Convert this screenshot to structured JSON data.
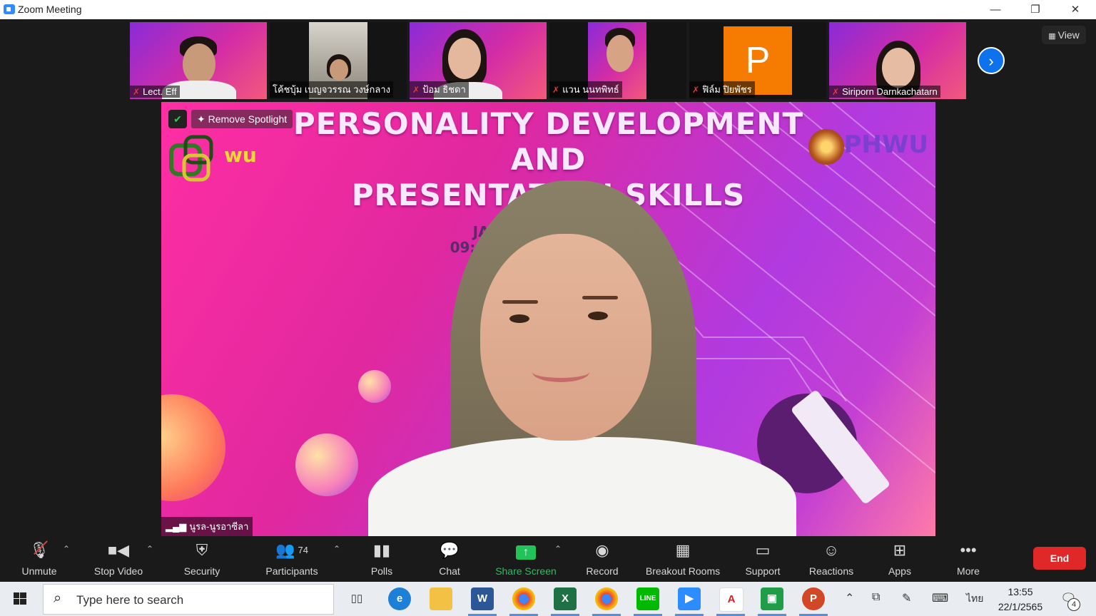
{
  "window": {
    "title": "Zoom Meeting",
    "minimize": "—",
    "restore": "❐",
    "close": "✕"
  },
  "gallery": {
    "participants": [
      {
        "name": "Lect. Eff"
      },
      {
        "name": "โค้ชบุ้ม เบญจวรรณ วงษ์กลาง"
      },
      {
        "name": "ป้อม ธิชดา"
      },
      {
        "name": "แวน นนทพิทธ์"
      },
      {
        "name": "ฟิล์ม ปิยพัชร"
      },
      {
        "name": "Siriporn Darnkachatarn"
      }
    ],
    "avatar_letter": "P",
    "view_label": "View"
  },
  "spotlight": {
    "remove_label": "Remove Spotlight",
    "speaker_name": "นูรล-นูรอาซีลา",
    "slide_title_1": "PERSONALITY DEVELOPMENT",
    "slide_title_2": "AND",
    "slide_title_3": "PRESENTATION SKILLS",
    "slide_date": "JANUARY 2          ONLINE",
    "slide_time": "09:",
    "logo_right": "PHWU",
    "logo_left": "wu"
  },
  "toolbar": {
    "unmute": "Unmute",
    "stop_video": "Stop Video",
    "security": "Security",
    "participants": "Participants",
    "participant_count": "74",
    "polls": "Polls",
    "chat": "Chat",
    "share_screen": "Share Screen",
    "record": "Record",
    "breakout_rooms": "Breakout Rooms",
    "support": "Support",
    "reactions": "Reactions",
    "apps": "Apps",
    "more": "More",
    "end": "End"
  },
  "taskbar": {
    "search_placeholder": "Type here to search",
    "time": "13:55",
    "date": "22/1/2565",
    "language": "ไทย",
    "notification_count": "4"
  },
  "colors": {
    "zoom_blue": "#0e72ed",
    "end_red": "#e02828",
    "share_green": "#22c45a",
    "muted_red": "#e23b3b"
  }
}
